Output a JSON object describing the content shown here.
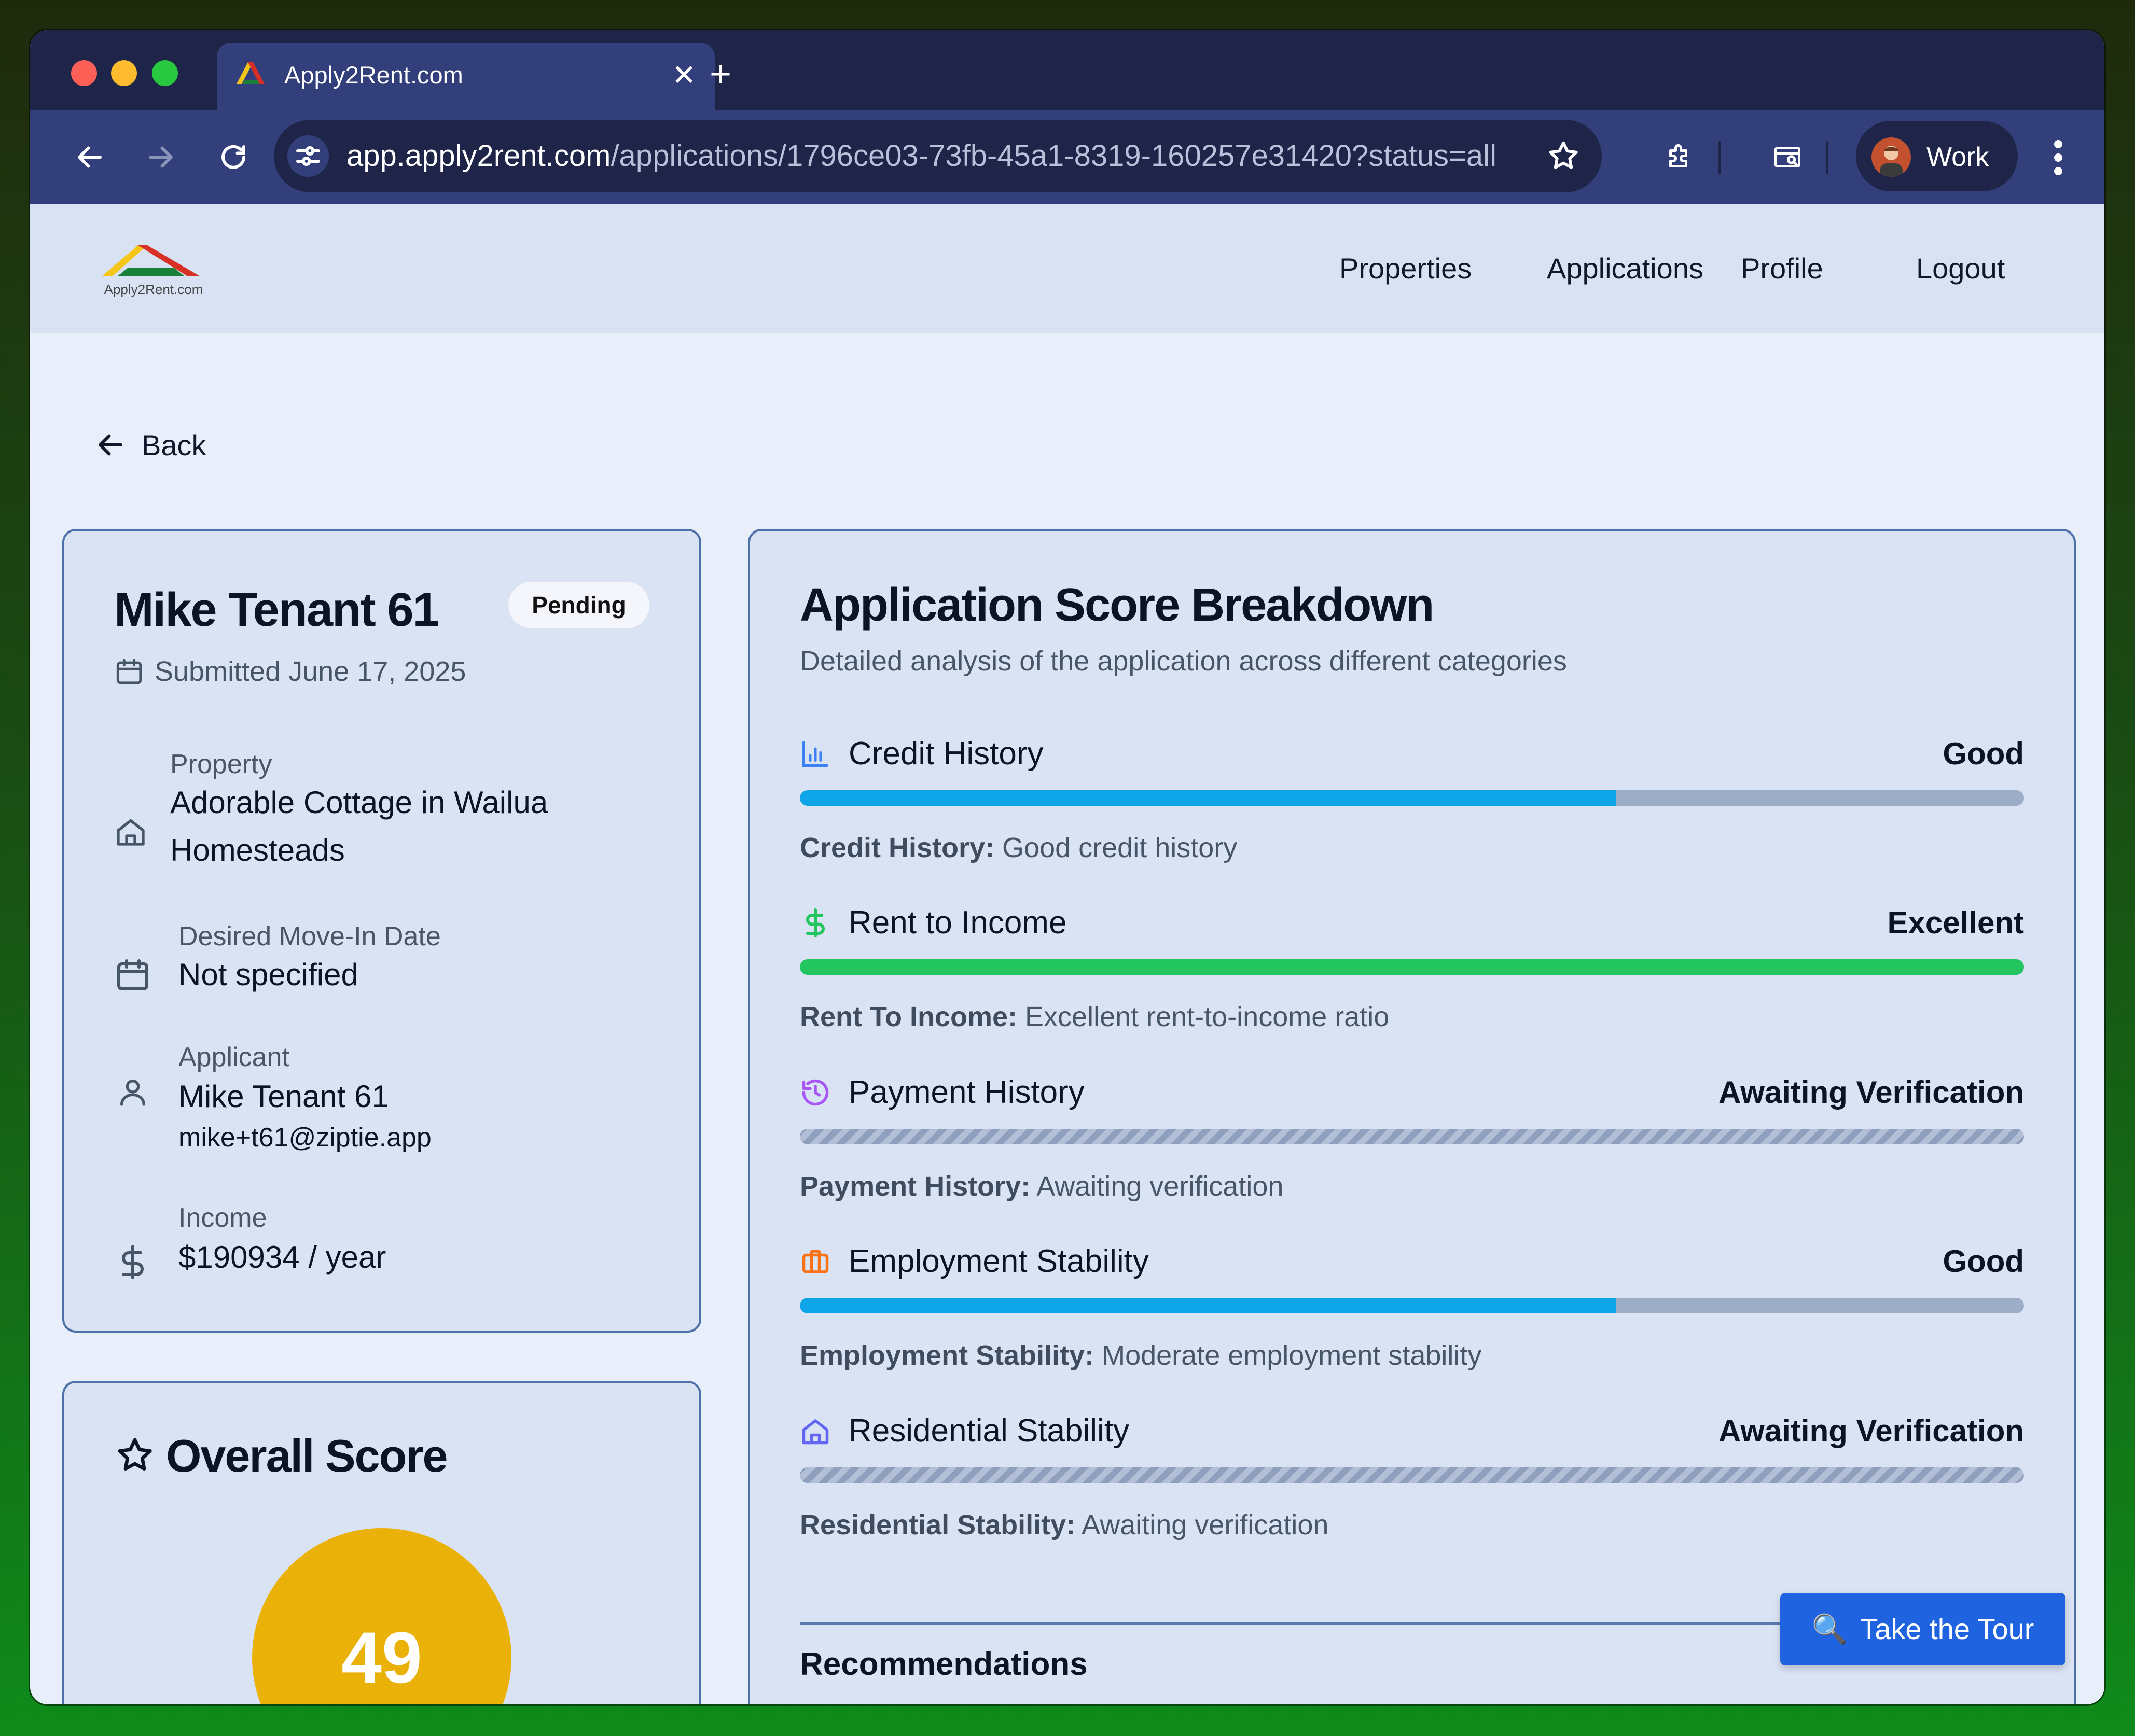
{
  "browser": {
    "tab_title": "Apply2Rent.com",
    "url_host": "app.apply2rent.com",
    "url_path": "/applications/1796ce03-73fb-45a1-8319-160257e31420?status=all",
    "profile_name": "Work"
  },
  "site": {
    "logo_text": "Apply2Rent.com",
    "nav": [
      "Properties",
      "Applications",
      "Profile",
      "Logout"
    ]
  },
  "back_label": "Back",
  "applicant_card": {
    "name": "Mike Tenant 61",
    "status": "Pending",
    "submitted": "Submitted June 17, 2025",
    "property_label": "Property",
    "property_line1": "Adorable Cottage in Wailua",
    "property_line2": "Homesteads",
    "move_in_label": "Desired Move-In Date",
    "move_in_value": "Not specified",
    "applicant_label": "Applicant",
    "applicant_name": "Mike Tenant 61",
    "applicant_email": "mike+t61@ziptie.app",
    "income_label": "Income",
    "income_value": "$190934 / year"
  },
  "overall_score": {
    "title": "Overall Score",
    "value": "49",
    "color": "#eab208"
  },
  "breakdown": {
    "title": "Application Score Breakdown",
    "description": "Detailed analysis of the application across different categories",
    "categories": [
      {
        "name": "Credit History",
        "rating": "Good",
        "progress": 0.667,
        "fill_color": "#0ea5e9",
        "icon": "bar-chart-icon",
        "icon_color": "#3b82f6",
        "desc_label": "Credit History:",
        "desc_text": " Good credit history"
      },
      {
        "name": "Rent to Income",
        "rating": "Excellent",
        "progress": 1.0,
        "fill_color": "#22c55e",
        "icon": "dollar-icon",
        "icon_color": "#22c55e",
        "desc_label": "Rent To Income:",
        "desc_text": " Excellent rent-to-income ratio"
      },
      {
        "name": "Payment History",
        "rating": "Awaiting Verification",
        "progress": null,
        "fill_color": "",
        "icon": "history-icon",
        "icon_color": "#a855f7",
        "desc_label": "Payment History:",
        "desc_text": " Awaiting verification"
      },
      {
        "name": "Employment Stability",
        "rating": "Good",
        "progress": 0.667,
        "fill_color": "#0ea5e9",
        "icon": "briefcase-icon",
        "icon_color": "#f97316",
        "desc_label": "Employment Stability:",
        "desc_text": " Moderate employment stability"
      },
      {
        "name": "Residential Stability",
        "rating": "Awaiting Verification",
        "progress": null,
        "fill_color": "",
        "icon": "home-icon",
        "icon_color": "#6366f1",
        "desc_label": "Residential Stability:",
        "desc_text": " Awaiting verification"
      }
    ],
    "recommendations_title": "Recommendations"
  },
  "tour_button": "Take the Tour"
}
